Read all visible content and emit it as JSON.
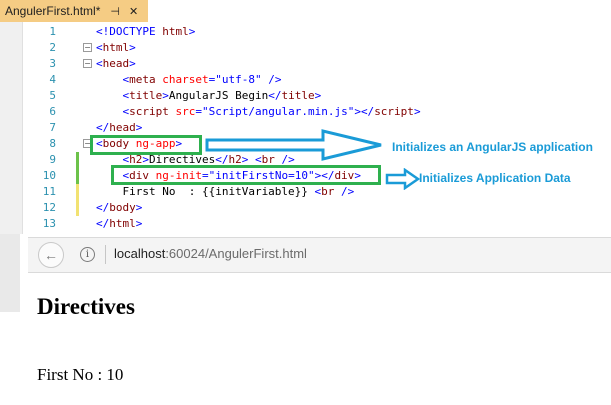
{
  "editor": {
    "tab_title": "AngulerFirst.html*",
    "tab_pin_glyph": "⊣",
    "tab_close_glyph": "✕",
    "lines": [
      {
        "num": "1",
        "fold": "",
        "change": "",
        "tokens": [
          {
            "c": "v",
            "s": "<!DOCTYPE "
          },
          {
            "c": "t",
            "s": "html"
          },
          {
            "c": "v",
            "s": ">"
          }
        ]
      },
      {
        "num": "2",
        "fold": "−",
        "change": "",
        "tokens": [
          {
            "c": "v",
            "s": "<"
          },
          {
            "c": "t",
            "s": "html"
          },
          {
            "c": "v",
            "s": ">"
          }
        ]
      },
      {
        "num": "3",
        "fold": "−",
        "change": "",
        "tokens": [
          {
            "c": "v",
            "s": "<"
          },
          {
            "c": "t",
            "s": "head"
          },
          {
            "c": "v",
            "s": ">"
          }
        ]
      },
      {
        "num": "4",
        "fold": "",
        "change": "",
        "tokens": [
          {
            "c": "x",
            "s": "    "
          },
          {
            "c": "v",
            "s": "<"
          },
          {
            "c": "t",
            "s": "meta"
          },
          {
            "c": "x",
            "s": " "
          },
          {
            "c": "a",
            "s": "charset"
          },
          {
            "c": "v",
            "s": "=\"utf-8\" />"
          }
        ]
      },
      {
        "num": "5",
        "fold": "",
        "change": "",
        "tokens": [
          {
            "c": "x",
            "s": "    "
          },
          {
            "c": "v",
            "s": "<"
          },
          {
            "c": "t",
            "s": "title"
          },
          {
            "c": "v",
            "s": ">"
          },
          {
            "c": "x",
            "s": "AngularJS Begin"
          },
          {
            "c": "v",
            "s": "</"
          },
          {
            "c": "t",
            "s": "title"
          },
          {
            "c": "v",
            "s": ">"
          }
        ]
      },
      {
        "num": "6",
        "fold": "",
        "change": "",
        "tokens": [
          {
            "c": "x",
            "s": "    "
          },
          {
            "c": "v",
            "s": "<"
          },
          {
            "c": "t",
            "s": "script"
          },
          {
            "c": "x",
            "s": " "
          },
          {
            "c": "a",
            "s": "src"
          },
          {
            "c": "v",
            "s": "=\"Script/angular.min.js\"></"
          },
          {
            "c": "t",
            "s": "script"
          },
          {
            "c": "v",
            "s": ">"
          }
        ]
      },
      {
        "num": "7",
        "fold": "",
        "change": "",
        "tokens": [
          {
            "c": "v",
            "s": "</"
          },
          {
            "c": "t",
            "s": "head"
          },
          {
            "c": "v",
            "s": ">"
          }
        ]
      },
      {
        "num": "8",
        "fold": "−",
        "change": "",
        "tokens": [
          {
            "c": "v",
            "s": "<"
          },
          {
            "c": "t",
            "s": "body"
          },
          {
            "c": "x",
            "s": " "
          },
          {
            "c": "a",
            "s": "ng-app"
          },
          {
            "c": "v",
            "s": ">"
          }
        ]
      },
      {
        "num": "9",
        "fold": "",
        "change": "green",
        "tokens": [
          {
            "c": "x",
            "s": "    "
          },
          {
            "c": "v",
            "s": "<"
          },
          {
            "c": "t",
            "s": "h2"
          },
          {
            "c": "v",
            "s": ">"
          },
          {
            "c": "x",
            "s": "Directives"
          },
          {
            "c": "v",
            "s": "</"
          },
          {
            "c": "t",
            "s": "h2"
          },
          {
            "c": "v",
            "s": "> <"
          },
          {
            "c": "t",
            "s": "br"
          },
          {
            "c": "v",
            "s": " />"
          }
        ]
      },
      {
        "num": "10",
        "fold": "",
        "change": "green",
        "tokens": [
          {
            "c": "x",
            "s": "    "
          },
          {
            "c": "v",
            "s": "<"
          },
          {
            "c": "t",
            "s": "div"
          },
          {
            "c": "x",
            "s": " "
          },
          {
            "c": "a",
            "s": "ng-init"
          },
          {
            "c": "v",
            "s": "=\"initFirstNo=10\"></"
          },
          {
            "c": "t",
            "s": "div"
          },
          {
            "c": "v",
            "s": ">"
          }
        ]
      },
      {
        "num": "11",
        "fold": "",
        "change": "yellow",
        "tokens": [
          {
            "c": "x",
            "s": "    First No  : {{initVariable}} "
          },
          {
            "c": "v",
            "s": "<"
          },
          {
            "c": "t",
            "s": "br"
          },
          {
            "c": "v",
            "s": " />"
          }
        ]
      },
      {
        "num": "12",
        "fold": "",
        "change": "yellow",
        "tokens": [
          {
            "c": "v",
            "s": "</"
          },
          {
            "c": "t",
            "s": "body"
          },
          {
            "c": "v",
            "s": ">"
          }
        ]
      },
      {
        "num": "13",
        "fold": "",
        "change": "",
        "tokens": [
          {
            "c": "v",
            "s": "</"
          },
          {
            "c": "t",
            "s": "html"
          },
          {
            "c": "v",
            "s": ">"
          }
        ]
      }
    ]
  },
  "annotations": {
    "callout_app": "Initializes an AngularJS application",
    "callout_data": "Initializes Application Data",
    "box_color": "#2eb04e",
    "arrow_color": "#1a9bd7"
  },
  "browser": {
    "back_icon": "←",
    "info_icon": "i",
    "url_host": "localhost",
    "url_rest": ":60024/AngulerFirst.html"
  },
  "page": {
    "heading": "Directives",
    "first_no": "First No : 10"
  },
  "colors": {
    "tag": "#800000",
    "attribute": "#ff0000",
    "delimiter": "#0000ff",
    "line_number": "#2b91af",
    "tab_active": "#f5cc84"
  }
}
